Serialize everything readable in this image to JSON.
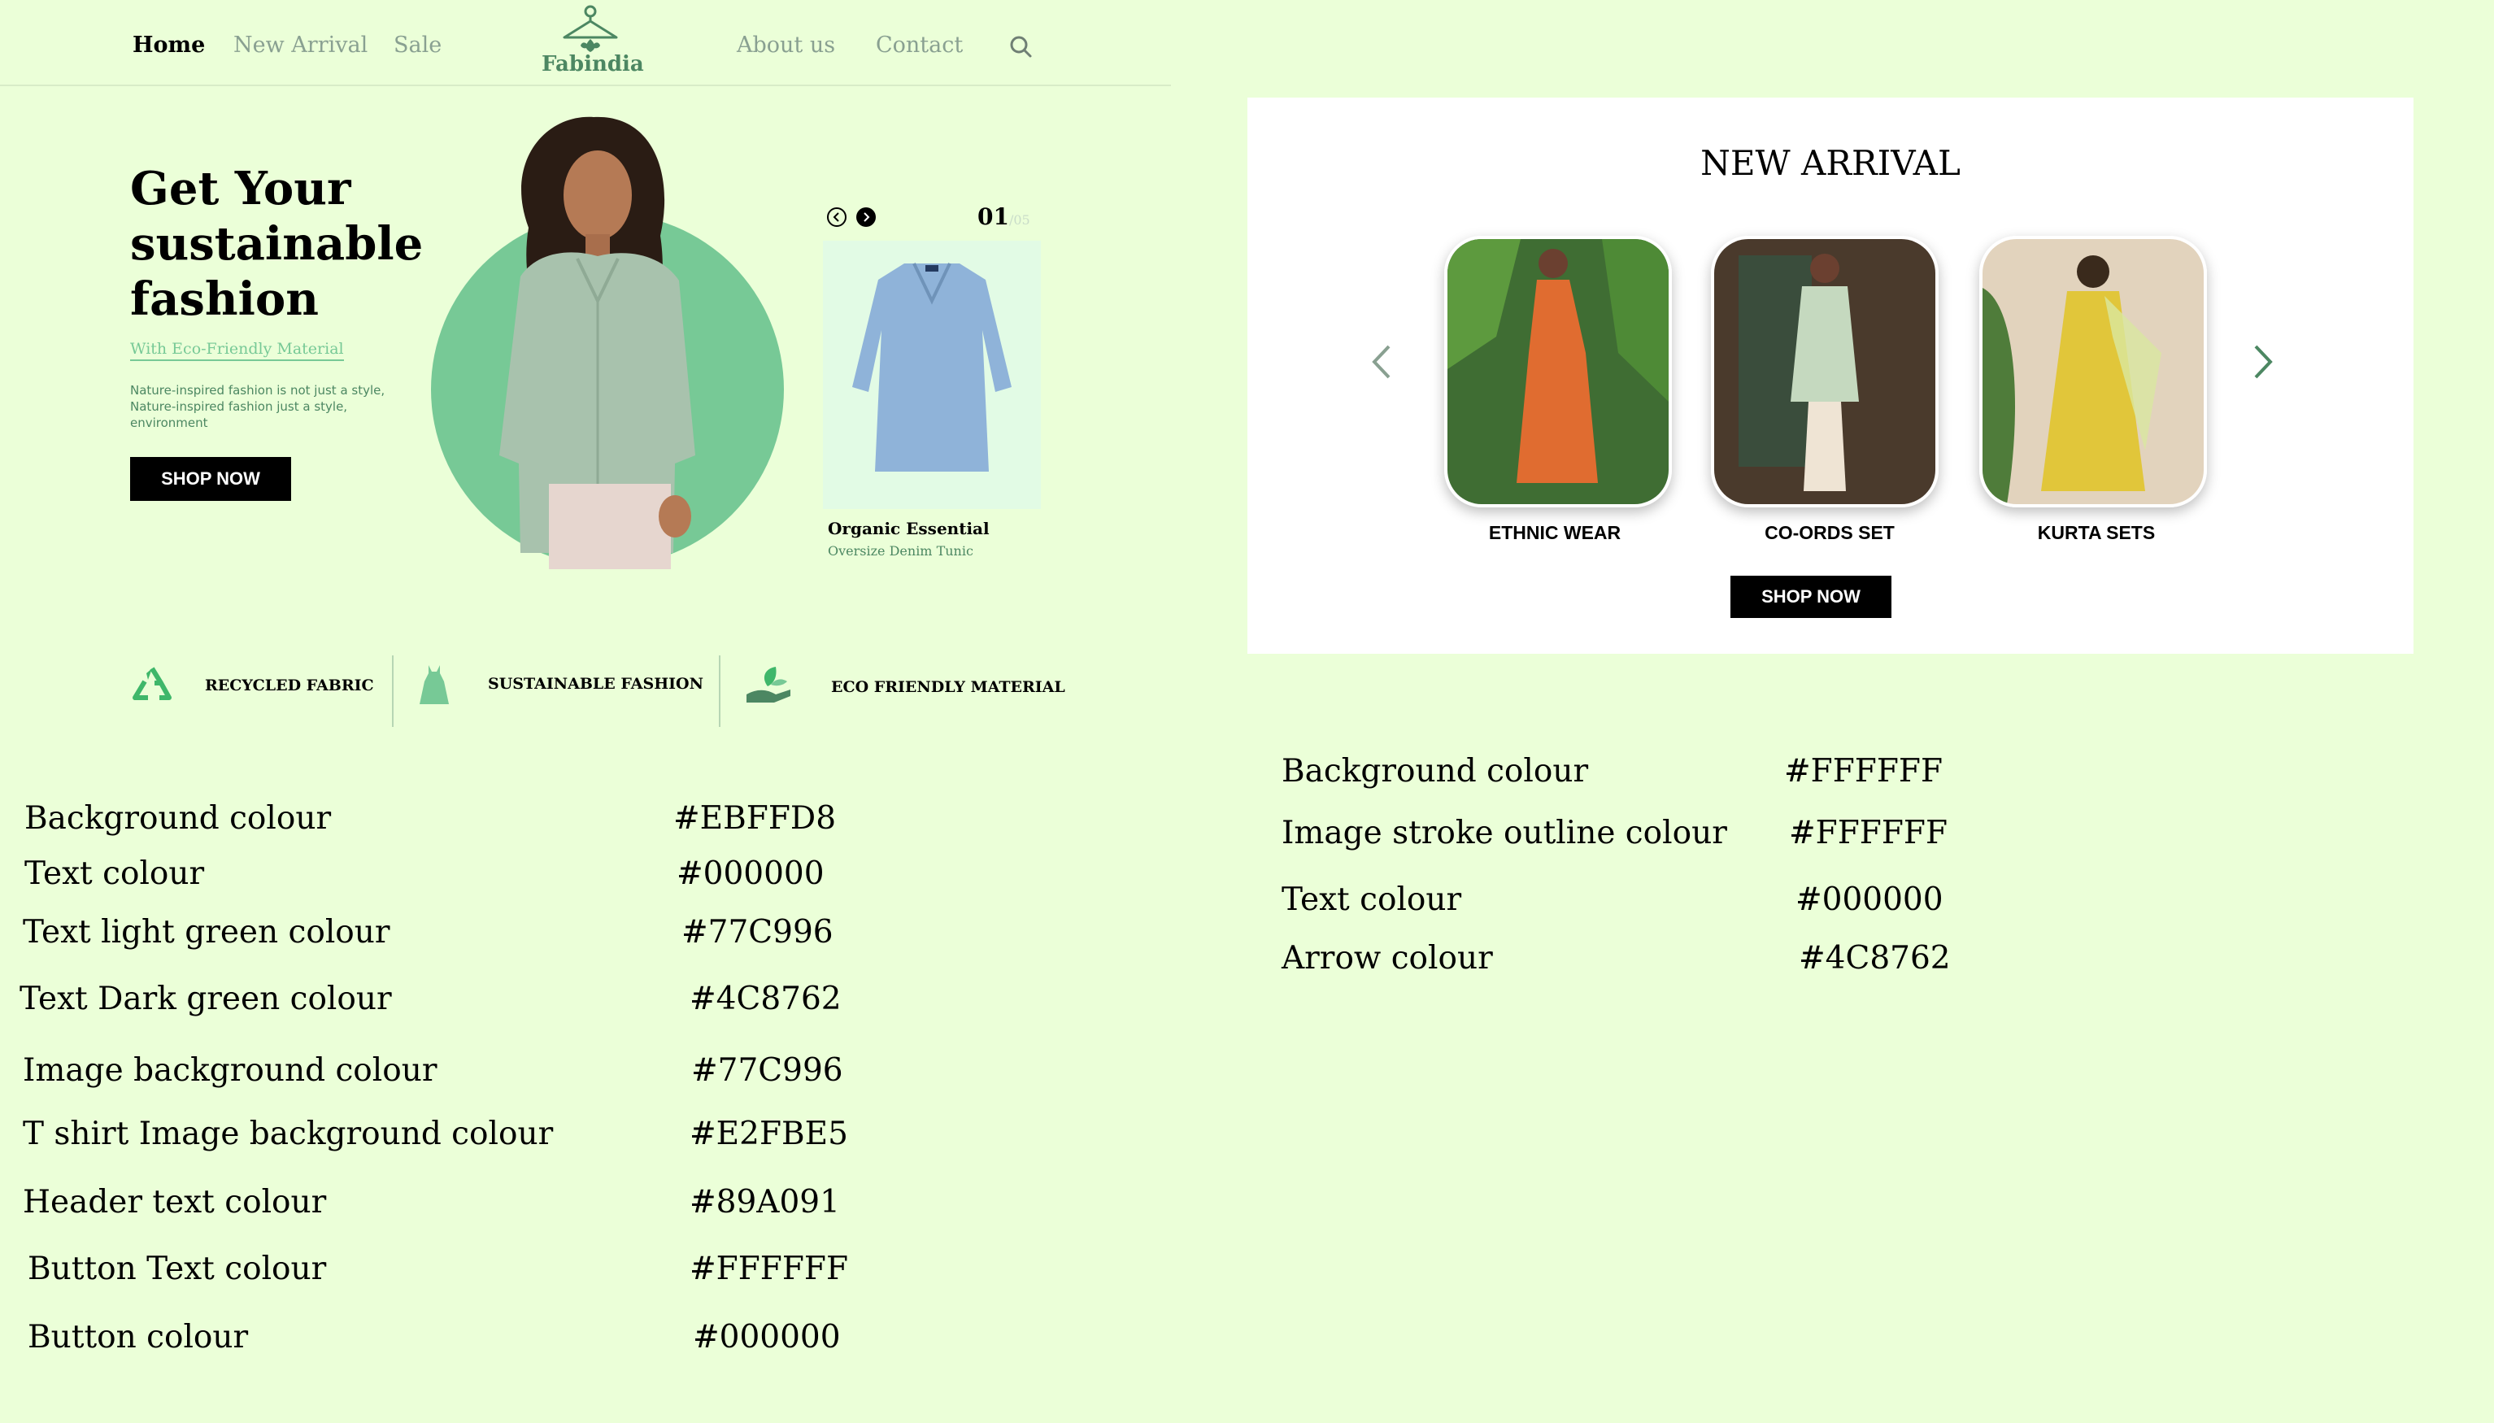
{
  "nav": {
    "links": [
      "Home",
      "New Arrival",
      "Sale",
      "About us",
      "Contact"
    ],
    "brand": "Fabindia"
  },
  "hero": {
    "title_lines": [
      "Get Your",
      "sustainable",
      "fashion"
    ],
    "subtitle": "With Eco-Friendly Material",
    "description": "Nature-inspired fashion is not just a style, Nature-inspired fashion just a style, environment",
    "button": "SHOP NOW"
  },
  "product": {
    "counter": "01",
    "counter_total": "/05",
    "name": "Organic Essential",
    "subtitle": "Oversize Denim Tunic"
  },
  "features": [
    "RECYCLED FABRIC",
    "SUSTAINABLE FASHION",
    "ECO FRIENDLY MATERIAL"
  ],
  "left_colors": [
    {
      "label": "Background colour",
      "value": "#EBFFD8"
    },
    {
      "label": "Text colour",
      "value": "#000000"
    },
    {
      "label": "Text light green  colour",
      "value": "#77C996"
    },
    {
      "label": "Text Dark green  colour",
      "value": "#4C8762"
    },
    {
      "label": "Image background colour",
      "value": "#77C996"
    },
    {
      "label": "T shirt Image background colour",
      "value": "#E2FBE5"
    },
    {
      "label": "Header text colour",
      "value": "#89A091"
    },
    {
      "label": "Button Text colour",
      "value": "#FFFFFF"
    },
    {
      "label": "Button  colour",
      "value": "#000000"
    }
  ],
  "new_arrival": {
    "title": "NEW ARRIVAL",
    "cards": [
      "ETHNIC WEAR",
      "CO-ORDS SET",
      "KURTA SETS"
    ],
    "button": "SHOP NOW"
  },
  "right_colors": [
    {
      "label": "Background colour",
      "value": "#FFFFFF"
    },
    {
      "label": "Image stroke outline colour",
      "value": "#FFFFFF"
    },
    {
      "label": "Text colour",
      "value": "#000000"
    },
    {
      "label": "Arrow colour",
      "value": "#4C8762"
    }
  ],
  "theme": {
    "background": "#EBFFD8",
    "light_green": "#77C996",
    "dark_green": "#4C8762",
    "header_text": "#89A091",
    "tunic_bg": "#E2FBE5"
  },
  "icons": [
    "hanger-logo-icon",
    "search-icon",
    "prev-circle-icon",
    "next-circle-icon",
    "recycle-icon",
    "dress-icon",
    "leaf-hand-icon",
    "chevron-left-icon",
    "chevron-right-icon"
  ]
}
